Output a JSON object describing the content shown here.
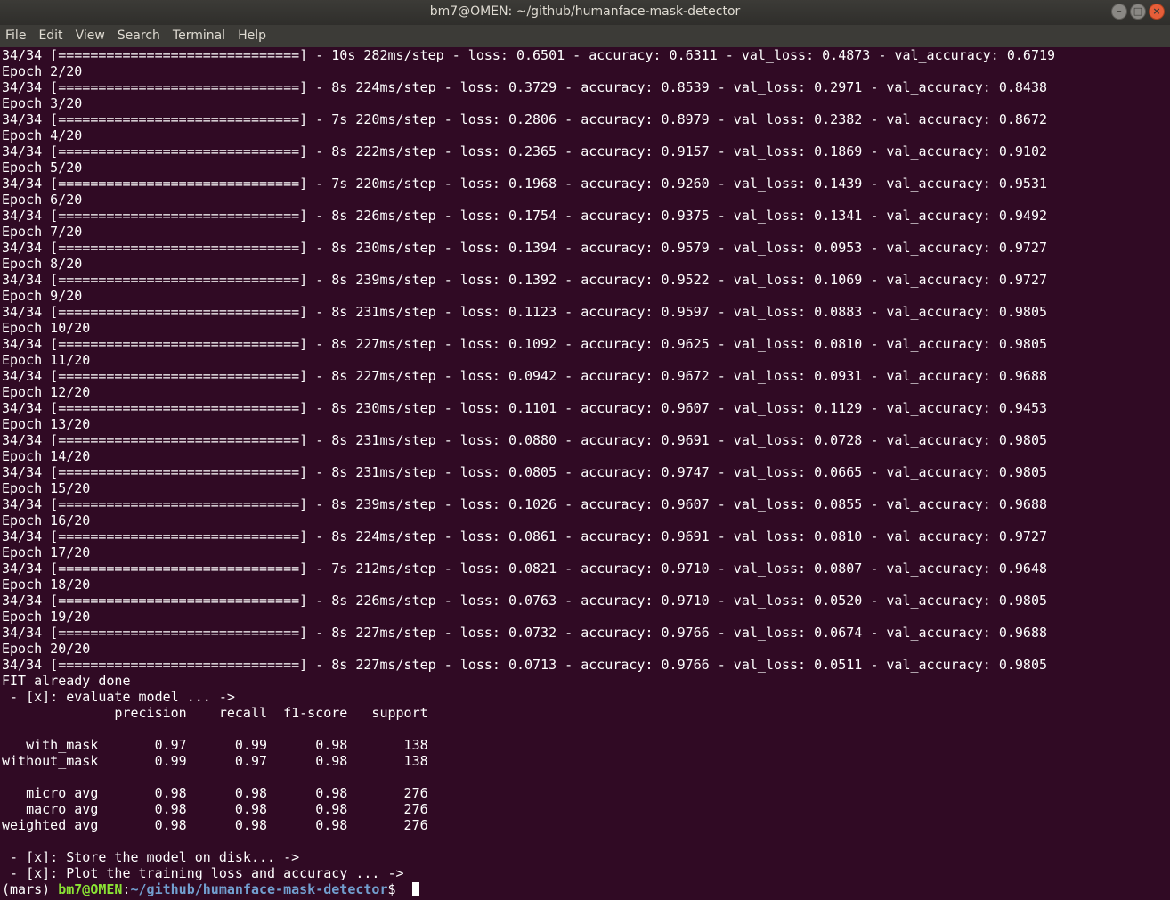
{
  "window": {
    "title": "bm7@OMEN: ~/github/humanface-mask-detector",
    "controls": [
      "minimize-icon",
      "maximize-icon",
      "close-icon"
    ]
  },
  "menu": {
    "items": [
      "File",
      "Edit",
      "View",
      "Search",
      "Terminal",
      "Help"
    ]
  },
  "terminal": {
    "lines": [
      "34/34 [==============================] - 10s 282ms/step - loss: 0.6501 - accuracy: 0.6311 - val_loss: 0.4873 - val_accuracy: 0.6719",
      "Epoch 2/20",
      "34/34 [==============================] - 8s 224ms/step - loss: 0.3729 - accuracy: 0.8539 - val_loss: 0.2971 - val_accuracy: 0.8438",
      "Epoch 3/20",
      "34/34 [==============================] - 7s 220ms/step - loss: 0.2806 - accuracy: 0.8979 - val_loss: 0.2382 - val_accuracy: 0.8672",
      "Epoch 4/20",
      "34/34 [==============================] - 8s 222ms/step - loss: 0.2365 - accuracy: 0.9157 - val_loss: 0.1869 - val_accuracy: 0.9102",
      "Epoch 5/20",
      "34/34 [==============================] - 7s 220ms/step - loss: 0.1968 - accuracy: 0.9260 - val_loss: 0.1439 - val_accuracy: 0.9531",
      "Epoch 6/20",
      "34/34 [==============================] - 8s 226ms/step - loss: 0.1754 - accuracy: 0.9375 - val_loss: 0.1341 - val_accuracy: 0.9492",
      "Epoch 7/20",
      "34/34 [==============================] - 8s 230ms/step - loss: 0.1394 - accuracy: 0.9579 - val_loss: 0.0953 - val_accuracy: 0.9727",
      "Epoch 8/20",
      "34/34 [==============================] - 8s 239ms/step - loss: 0.1392 - accuracy: 0.9522 - val_loss: 0.1069 - val_accuracy: 0.9727",
      "Epoch 9/20",
      "34/34 [==============================] - 8s 231ms/step - loss: 0.1123 - accuracy: 0.9597 - val_loss: 0.0883 - val_accuracy: 0.9805",
      "Epoch 10/20",
      "34/34 [==============================] - 8s 227ms/step - loss: 0.1092 - accuracy: 0.9625 - val_loss: 0.0810 - val_accuracy: 0.9805",
      "Epoch 11/20",
      "34/34 [==============================] - 8s 227ms/step - loss: 0.0942 - accuracy: 0.9672 - val_loss: 0.0931 - val_accuracy: 0.9688",
      "Epoch 12/20",
      "34/34 [==============================] - 8s 230ms/step - loss: 0.1101 - accuracy: 0.9607 - val_loss: 0.1129 - val_accuracy: 0.9453",
      "Epoch 13/20",
      "34/34 [==============================] - 8s 231ms/step - loss: 0.0880 - accuracy: 0.9691 - val_loss: 0.0728 - val_accuracy: 0.9805",
      "Epoch 14/20",
      "34/34 [==============================] - 8s 231ms/step - loss: 0.0805 - accuracy: 0.9747 - val_loss: 0.0665 - val_accuracy: 0.9805",
      "Epoch 15/20",
      "34/34 [==============================] - 8s 239ms/step - loss: 0.1026 - accuracy: 0.9607 - val_loss: 0.0855 - val_accuracy: 0.9688",
      "Epoch 16/20",
      "34/34 [==============================] - 8s 224ms/step - loss: 0.0861 - accuracy: 0.9691 - val_loss: 0.0810 - val_accuracy: 0.9727",
      "Epoch 17/20",
      "34/34 [==============================] - 7s 212ms/step - loss: 0.0821 - accuracy: 0.9710 - val_loss: 0.0807 - val_accuracy: 0.9648",
      "Epoch 18/20",
      "34/34 [==============================] - 8s 226ms/step - loss: 0.0763 - accuracy: 0.9710 - val_loss: 0.0520 - val_accuracy: 0.9805",
      "Epoch 19/20",
      "34/34 [==============================] - 8s 227ms/step - loss: 0.0732 - accuracy: 0.9766 - val_loss: 0.0674 - val_accuracy: 0.9688",
      "Epoch 20/20",
      "34/34 [==============================] - 8s 227ms/step - loss: 0.0713 - accuracy: 0.9766 - val_loss: 0.0511 - val_accuracy: 0.9805",
      "FIT already done",
      " - [x]: evaluate model ... ->",
      "              precision    recall  f1-score   support",
      "",
      "   with_mask       0.97      0.99      0.98       138",
      "without_mask       0.99      0.97      0.98       138",
      "",
      "   micro avg       0.98      0.98      0.98       276",
      "   macro avg       0.98      0.98      0.98       276",
      "weighted avg       0.98      0.98      0.98       276",
      "",
      " - [x]: Store the model on disk... ->",
      " - [x]: Plot the training loss and accuracy ... ->"
    ],
    "prompt": {
      "env": "(mars) ",
      "user_host": "bm7@OMEN",
      "sep": ":",
      "path": "~/github/humanface-mask-detector",
      "dollar": "$ "
    }
  }
}
